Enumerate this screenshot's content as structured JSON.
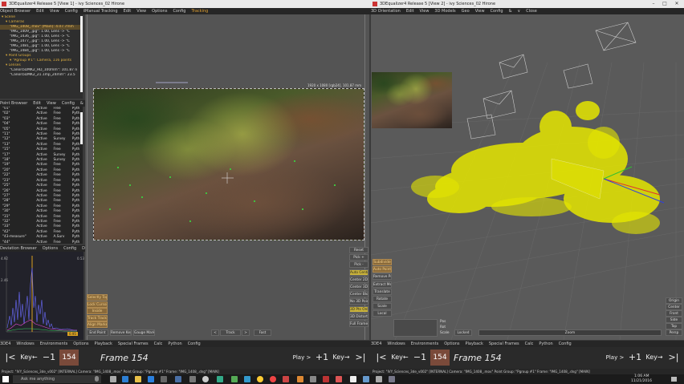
{
  "left_window": {
    "title": "3DEqualizer4 Release 5 [View 1] - ivy Sciences_02 Hirone",
    "object_browser_menu": [
      "Object Browser",
      "Edit",
      "View",
      "Config",
      "&",
      "∨",
      "Close"
    ],
    "tree": [
      {
        "label": "Scene",
        "kind": "folder",
        "indent": 0
      },
      {
        "label": "Cameras",
        "kind": "folder",
        "indent": 1
      },
      {
        "label": "\"IMG_1408_.mov\" [Main]: 4.07.7mm",
        "kind": "sel",
        "indent": 2
      },
      {
        "label": "\"IMG_1409_.jpg\": 1.00, Lens -> \"C",
        "kind": "item",
        "indent": 2
      },
      {
        "label": "\"IMG_1436_.jpg\": 1.00, Lens -> \"C",
        "kind": "item",
        "indent": 2
      },
      {
        "label": "\"IMG_1477_.jpg\": 1.00, Lens -> \"C",
        "kind": "item",
        "indent": 2
      },
      {
        "label": "\"IMG_1481_.jpg\": 1.00, Lens -> \"C",
        "kind": "item",
        "indent": 2
      },
      {
        "label": "\"IMG_1484_.jpg\": 1.00, Lens -> \"C",
        "kind": "item",
        "indent": 2
      },
      {
        "label": "Point Groups",
        "kind": "folder",
        "indent": 1
      },
      {
        "label": "\"Pgroup #1\": Camera, 116 points",
        "kind": "folder",
        "indent": 2
      },
      {
        "label": "Lenses",
        "kind": "folder",
        "indent": 1
      },
      {
        "label": "\"Canon5DMK2_HD_100mm\": 101.87 n",
        "kind": "item",
        "indent": 2
      },
      {
        "label": "\"Canon5DMK2_21.1mp_24mm\": 23.5",
        "kind": "item",
        "indent": 2
      }
    ],
    "point_browser_menu": [
      "Point Browser",
      "Edit",
      "View",
      "Config",
      "&",
      "∨",
      "Close"
    ],
    "points": [
      [
        "\"01\"",
        "Active",
        "Free",
        "Pyth"
      ],
      [
        "\"02\"",
        "Active",
        "Free",
        "Pyth"
      ],
      [
        "\"03\"",
        "Active",
        "Free",
        "Pyth"
      ],
      [
        "\"04\"",
        "Active",
        "Free",
        "Pyth"
      ],
      [
        "\"05\"",
        "Active",
        "Free",
        "Pyth"
      ],
      [
        "\"11\"",
        "Active",
        "Free",
        "Pyth"
      ],
      [
        "\"12\"",
        "Active",
        "Survey",
        "Pyth"
      ],
      [
        "\"13\"",
        "Active",
        "Free",
        "Pyth"
      ],
      [
        "\"15\"",
        "Active",
        "Free",
        "Pyth"
      ],
      [
        "\"17\"",
        "Active",
        "Survey",
        "Pyth"
      ],
      [
        "\"18\"",
        "Active",
        "Survey",
        "Pyth"
      ],
      [
        "\"19\"",
        "Active",
        "Free",
        "Pyth"
      ],
      [
        "\"20\"",
        "Active",
        "Free",
        "Pyth"
      ],
      [
        "\"22\"",
        "Active",
        "Free",
        "Pyth"
      ],
      [
        "\"23\"",
        "Active",
        "Free",
        "Pyth"
      ],
      [
        "\"25\"",
        "Active",
        "Free",
        "Pyth"
      ],
      [
        "\"26\"",
        "Active",
        "Free",
        "Pyth"
      ],
      [
        "\"27\"",
        "Active",
        "Free",
        "Pyth"
      ],
      [
        "\"28\"",
        "Active",
        "Free",
        "Pyth"
      ],
      [
        "\"29\"",
        "Active",
        "Free",
        "Pyth"
      ],
      [
        "\"30\"",
        "Active",
        "Free",
        "Pyth"
      ],
      [
        "\"31\"",
        "Active",
        "Free",
        "Pyth"
      ],
      [
        "\"32\"",
        "Active",
        "Free",
        "Pyth"
      ],
      [
        "\"33\"",
        "Active",
        "Free",
        "Pyth"
      ],
      [
        "\"42\"",
        "Active",
        "Free",
        "Pyth"
      ],
      [
        "\"43-measure\"",
        "Active",
        "A.Surv",
        "Pyth"
      ],
      [
        "\"44\"",
        "Active",
        "Free",
        "Pyth"
      ]
    ],
    "deviation_menu": [
      "Deviation Browser",
      "Options",
      "Config",
      "Disk",
      "&",
      "∨",
      "Close"
    ],
    "deviation": {
      "y_top": "4.92",
      "y_mid": "2.46",
      "x_right": "0.53",
      "tag": "0.95"
    },
    "viewport_menu": [
      "Manual Tracking",
      "Edit",
      "View",
      "Options",
      "Config",
      "Tracking"
    ],
    "viewport_info": "1920 x 1080 [rgb24], 101.87 mm",
    "side_buttons": [
      "Reset",
      "Pick +",
      "Pick -",
      "Auto Center",
      "Center 2D",
      "Center 3D",
      "Center Blob",
      "No 3D Points",
      "3D Pts Only",
      "3D Distortion",
      "Full Frame"
    ],
    "left_tool_buttons": [
      "Selectly Toggle",
      "Lock Cursor",
      "Inside",
      "Track Tracker",
      "Align Marker"
    ],
    "bottom_buttons": {
      "end_point": "End Point",
      "remove_key": "Remove Key",
      "gauge_marker": "Gauge Marker",
      "track_prev": "<",
      "track": "Track",
      "track_next": ">",
      "fast": "Fast"
    },
    "menu": [
      "3DE4",
      "Windows",
      "Environments",
      "Options",
      "Playback",
      "Special Frames",
      "Calc",
      "Python",
      "Config"
    ],
    "frame": {
      "number": "154",
      "label": "Frame 154",
      "key_prev": "Key←",
      "minus": "−1",
      "start": "|<",
      "play": "Play >",
      "plus": "+1",
      "key_next": "Key→",
      "end": ">|"
    },
    "status": "Project: \"IVY_Sciences_3de_v002\"   [INTERNAL]   Camera: \"IMG_1408_.mov\"   Point Group: \"Pgroup #1\"   Frame: \"IMG_1408_.dng\"   [MAIN]"
  },
  "right_window": {
    "title": "3DEqualizer4 Release 5 [View 2] - ivy Sciences_02 Hirone",
    "menu": [
      "3D Orientation",
      "Edit",
      "View",
      "3D Models",
      "Geo",
      "View",
      "Config",
      "&",
      "∨",
      "Close"
    ],
    "side_buttons": [
      "Origin",
      "Center",
      "Front",
      "Side",
      "Top",
      "Persp"
    ],
    "left_tool_buttons": [
      "Subdivide",
      "Auto Point",
      "Remove Pgs",
      "Extract Mesh",
      "Translate",
      "Rotate",
      "Scale",
      "Local"
    ],
    "bottom_buttons": {
      "pos": "Pos",
      "rot": "Rot",
      "scale": "Scale",
      "locked": "Locked",
      "zoom": "Zoom"
    },
    "bottom_menu": [
      "3DE4",
      "Windows",
      "Environments",
      "Options",
      "Playback",
      "Special Frames",
      "Calc",
      "Python",
      "Config"
    ],
    "frame": {
      "number": "154",
      "label": "Frame 154",
      "key_prev": "Key←",
      "minus": "−1",
      "start": "|<",
      "play": "Play >",
      "plus": "+1",
      "key_next": "Key→",
      "end": ">|"
    },
    "status": "Project: \"IVY_Sciences_3de_v002\"   [INTERNAL]   Camera: \"IMG_1408_.mov\"   Point Group: \"Pgroup #1\"   Frame: \"IMG_1408_.dng\"   [MAIN]"
  },
  "taskbar": {
    "search_placeholder": "Ask me anything",
    "time": "1:06 AM",
    "date": "11/21/2016"
  },
  "colors": {
    "accent": "#e0a030",
    "point_cloud": "#e5e600",
    "frame_highlight": "#7a4a3a"
  }
}
